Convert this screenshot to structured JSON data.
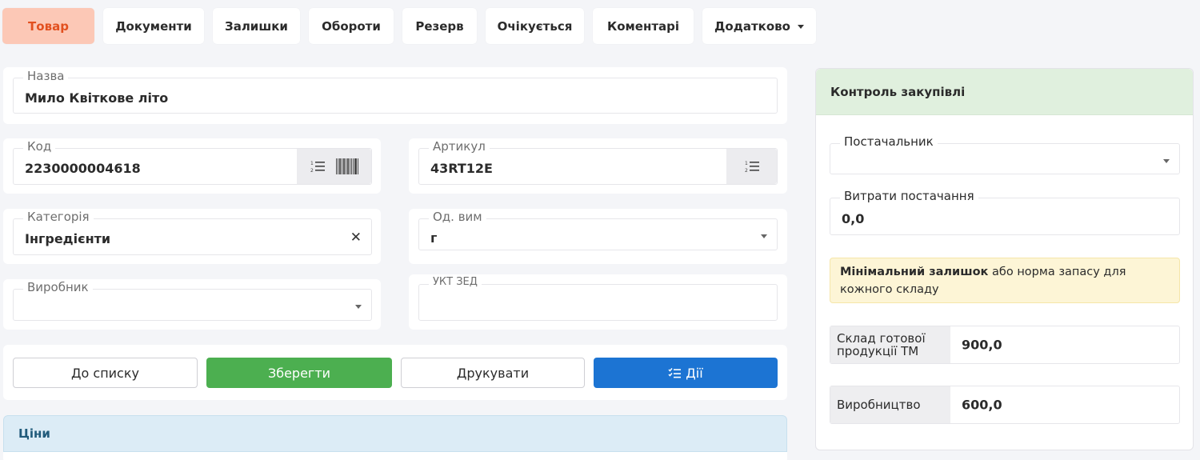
{
  "tabs": [
    {
      "label": "Товар"
    },
    {
      "label": "Документи"
    },
    {
      "label": "Залишки"
    },
    {
      "label": "Обороти"
    },
    {
      "label": "Резерв"
    },
    {
      "label": "Очікується"
    },
    {
      "label": "Коментарі"
    },
    {
      "label": "Додатково"
    }
  ],
  "form": {
    "name": {
      "label": "Назва",
      "value": "Мило Квіткове літо"
    },
    "code": {
      "label": "Код",
      "value": "2230000004618"
    },
    "article": {
      "label": "Артикул",
      "value": "43RT12E"
    },
    "category": {
      "label": "Категорія",
      "value": "Інгредієнти"
    },
    "unit": {
      "label": "Од. вим",
      "value": "г"
    },
    "manufacturer": {
      "label": "Виробник",
      "value": ""
    },
    "uktzed": {
      "label": "УКТ ЗЕД",
      "value": ""
    }
  },
  "actions": {
    "to_list": "До списку",
    "save": "Зберегти",
    "print": "Друкувати",
    "actions": "Дії"
  },
  "purchase": {
    "title": "Контроль закупівлі",
    "supplier_label": "Постачальник",
    "supplier_value": "",
    "cost_label": "Витрати постачання",
    "cost_value": "0,0",
    "note_bold": "Мінімальний залишок",
    "note_rest": " або норма запасу для кожного складу",
    "stocks": [
      {
        "name": "Склад готової продукції ТМ",
        "value": "900,0"
      },
      {
        "name": "Виробництво",
        "value": "600,0"
      }
    ]
  },
  "prices": {
    "title": "Ціни"
  },
  "colors": {
    "active_tab_bg": "#fcc8b6",
    "active_tab_text": "#e2501f",
    "save_green": "#4caf50",
    "actions_blue": "#1c74d3"
  }
}
